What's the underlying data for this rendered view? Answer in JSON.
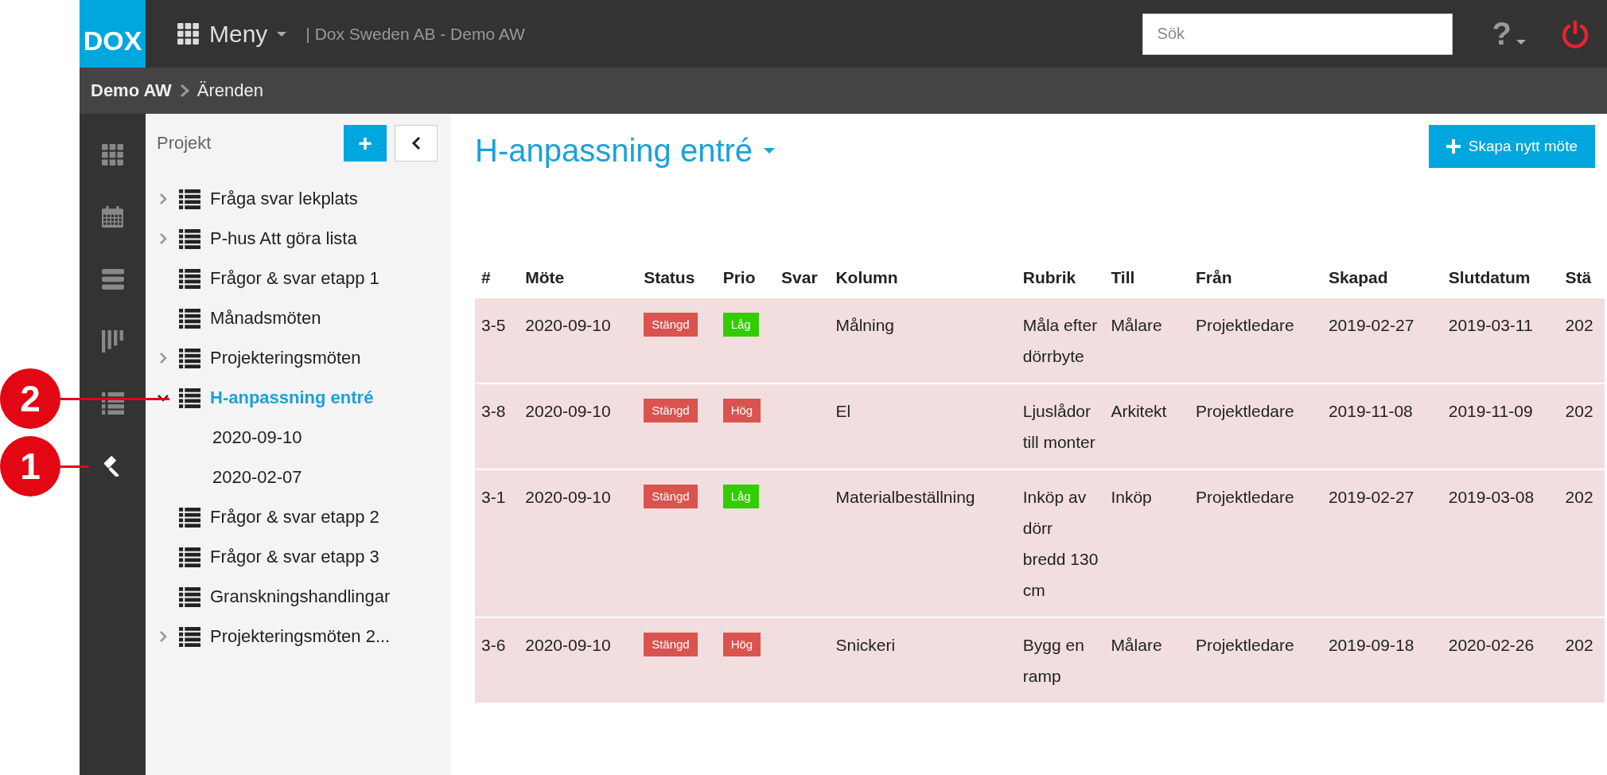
{
  "topbar": {
    "logo": "DOX",
    "menu": "Meny",
    "company": "| Dox Sweden AB - Demo AW",
    "search": {
      "placeholder": "Sök"
    },
    "help": "?"
  },
  "breadcrumb": [
    "Demo AW",
    "Ärenden"
  ],
  "rail": [
    {
      "selected": false
    },
    {
      "selected": false
    },
    {
      "selected": false
    },
    {
      "selected": false
    },
    {
      "selected": false
    },
    {
      "selected": true
    }
  ],
  "tree": {
    "title": "Projekt",
    "add_button": "+",
    "items": [
      {
        "label": "Fråga svar lekplats",
        "kind": "group",
        "expanded": false,
        "selected": false
      },
      {
        "label": "P-hus Att göra lista",
        "kind": "group",
        "expanded": false,
        "selected": false
      },
      {
        "label": "Frågor & svar etapp 1",
        "kind": "leaf",
        "selected": false
      },
      {
        "label": "Månadsmöten",
        "kind": "leaf",
        "selected": false
      },
      {
        "label": "Projekteringsmöten",
        "kind": "group",
        "expanded": false,
        "selected": false
      },
      {
        "label": "H-anpassning entré",
        "kind": "group",
        "expanded": true,
        "selected": true,
        "children": [
          {
            "label": "2020-09-10",
            "selected": false
          },
          {
            "label": "2020-02-07",
            "selected": false
          }
        ]
      },
      {
        "label": "Frågor & svar etapp 2",
        "kind": "leaf",
        "selected": false
      },
      {
        "label": "Frågor & svar etapp 3",
        "kind": "leaf",
        "selected": false
      },
      {
        "label": "Granskningshandlingar",
        "kind": "leaf",
        "selected": false
      },
      {
        "label": "Projekteringsmöten 2...",
        "kind": "group",
        "expanded": false,
        "selected": false
      }
    ]
  },
  "main": {
    "title": "H-anpassning entré",
    "create_button": "Skapa nytt möte"
  },
  "table": {
    "columns": [
      "#",
      "Möte",
      "Status",
      "Prio",
      "Svar",
      "Kolumn",
      "Rubrik",
      "Till",
      "Från",
      "Skapad",
      "Slutdatum",
      "Stä"
    ],
    "rows": [
      {
        "number": "3-5",
        "meeting": "2020-09-10",
        "status": {
          "text": "Stängd",
          "color": "#d9534f"
        },
        "priority": {
          "text": "Låg",
          "color": "#33cc00"
        },
        "column": "Målning",
        "subject": "Måla efter dörrbyte",
        "to": "Målare",
        "from": "Projektledare",
        "created": "2019-02-27",
        "end_date": "2019-03-11",
        "column_12": "202"
      },
      {
        "number": "3-8",
        "meeting": "2020-09-10",
        "status": {
          "text": "Stängd",
          "color": "#d9534f"
        },
        "priority": {
          "text": "Hög",
          "color": "#d9534f"
        },
        "column": "El",
        "subject": "Ljuslådor till monter",
        "to": "Arkitekt",
        "from": "Projektledare",
        "created": "2019-11-08",
        "end_date": "2019-11-09",
        "column_12": "202"
      },
      {
        "number": "3-1",
        "meeting": "2020-09-10",
        "status": {
          "text": "Stängd",
          "color": "#d9534f"
        },
        "priority": {
          "text": "Låg",
          "color": "#33cc00"
        },
        "column": "Materialbeställning",
        "subject": "Inköp av dörr bredd 130 cm",
        "to": "Inköp",
        "from": "Projektledare",
        "created": "2019-02-27",
        "end_date": "2019-03-08",
        "column_12": "202"
      },
      {
        "number": "3-6",
        "meeting": "2020-09-10",
        "status": {
          "text": "Stängd",
          "color": "#d9534f"
        },
        "priority": {
          "text": "Hög",
          "color": "#d9534f"
        },
        "column": "Snickeri",
        "subject": "Bygg en ramp",
        "to": "Målare",
        "from": "Projektledare",
        "created": "2019-09-18",
        "end_date": "2020-02-26",
        "column_12": "202"
      }
    ]
  },
  "callouts": [
    {
      "label": "2"
    },
    {
      "label": "1"
    }
  ]
}
